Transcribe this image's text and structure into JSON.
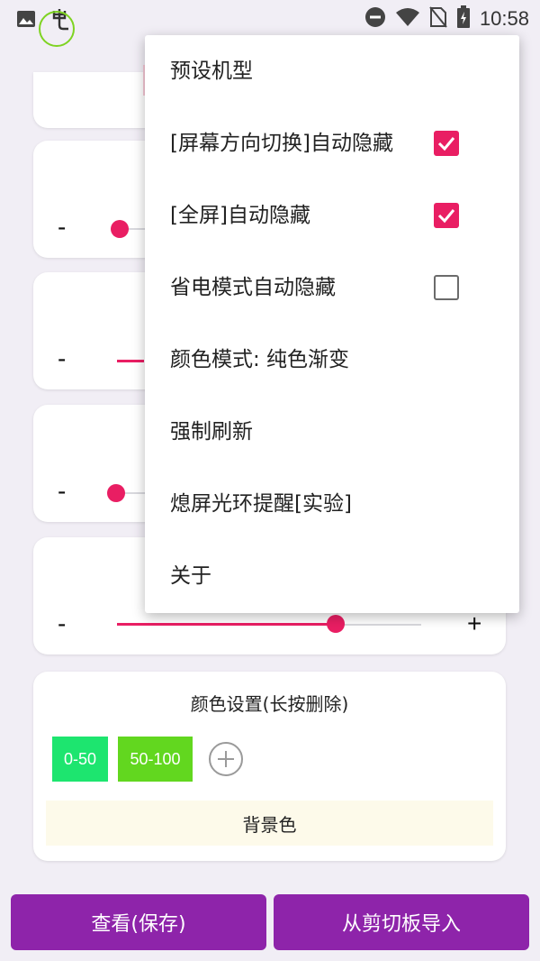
{
  "status_bar": {
    "time": "10:58",
    "icons": [
      "image-icon",
      "app-notification-icon",
      "do-not-disturb-icon",
      "wifi-icon",
      "no-sim-icon",
      "battery-charging-icon"
    ]
  },
  "sliders": [
    {
      "minus_label": "-",
      "value": 0.0
    },
    {
      "minus_label": "-",
      "value": 0.0
    },
    {
      "minus_label": "-",
      "value": 0.0
    },
    {
      "minus_label": "-",
      "plus_label": "+",
      "value": 0.72
    }
  ],
  "color_settings": {
    "title": "颜色设置(长按删除)",
    "chips": [
      {
        "label": "0-50",
        "color": "#1de56f"
      },
      {
        "label": "50-100",
        "color": "#62d71f"
      }
    ],
    "background_label": "背景色"
  },
  "buttons": {
    "view_save": "查看(保存)",
    "import_clipboard": "从剪切板导入"
  },
  "menu": {
    "items": [
      {
        "label": "预设机型"
      },
      {
        "label": "[屏幕方向切换]自动隐藏",
        "checked": true
      },
      {
        "label": "[全屏]自动隐藏",
        "checked": true
      },
      {
        "label": "省电模式自动隐藏",
        "checked": false
      },
      {
        "label": "颜色模式: 纯色渐变"
      },
      {
        "label": "强制刷新"
      },
      {
        "label": "熄屏光环提醒[实验]"
      },
      {
        "label": "关于"
      }
    ]
  },
  "colors": {
    "accent": "#e91e63",
    "button_purple": "#8e24aa",
    "ring_green": "#7ed321"
  }
}
